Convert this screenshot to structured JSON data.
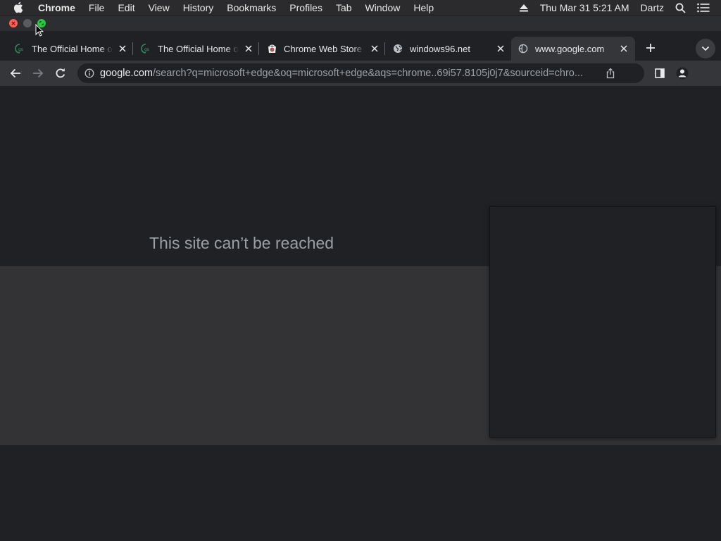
{
  "menubar": {
    "app_name": "Chrome",
    "items": [
      "File",
      "Edit",
      "View",
      "History",
      "Bookmarks",
      "Profiles",
      "Tab",
      "Window",
      "Help"
    ],
    "clock": "Thu Mar 31  5:21 AM",
    "user": "Dartz"
  },
  "tabs": [
    {
      "title": "The Official Home of",
      "favicon": "gs-logo-icon",
      "active": false
    },
    {
      "title": "The Official Home of",
      "favicon": "gs-logo-icon",
      "active": false
    },
    {
      "title": "Chrome Web Store - ",
      "favicon": "web-store-icon",
      "active": false
    },
    {
      "title": "windows96.net",
      "favicon": "globe-icon",
      "active": false
    },
    {
      "title": "www.google.com",
      "favicon": "broken-globe-icon",
      "active": true
    }
  ],
  "omnibox": {
    "host": "google.com",
    "path": "/search?q=microsoft+edge&oq=microsoft+edge&aqs=chrome..69i57.8105j0j7&sourceid=chro..."
  },
  "page": {
    "heading": "This site can’t be reached"
  },
  "colors": {
    "background": "#202124",
    "toolbar": "#35363a",
    "band": "#333336",
    "close": "#ff5f57",
    "maximize": "#28c840"
  }
}
